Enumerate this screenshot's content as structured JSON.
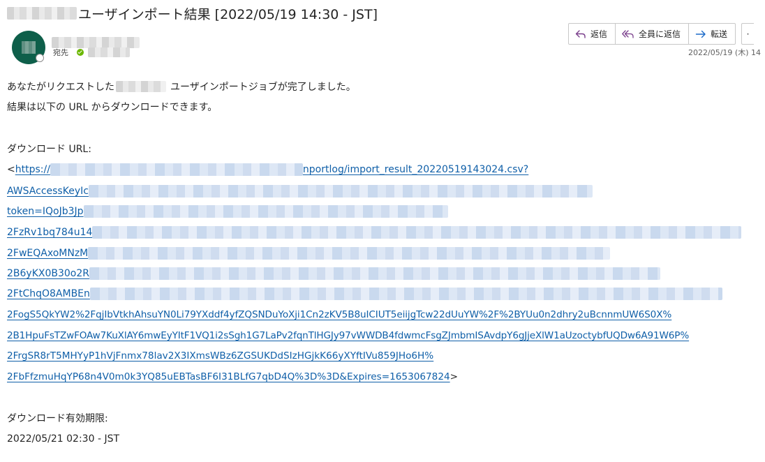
{
  "subject": {
    "text": "ユーザインポート結果 [2022/05/19 14:30 - JST]"
  },
  "header": {
    "to_label": "宛先",
    "date": "2022/05/19 (木) 14"
  },
  "toolbar": {
    "reply": "返信",
    "reply_all": "全員に返信",
    "forward": "転送",
    "more": "·"
  },
  "body": {
    "line1_pre": "あなたがリクエストした",
    "line1_post": "ユーザインポートジョブが完了しました。",
    "line2": "結果は以下の URL からダウンロードできます。",
    "download_url_label": "ダウンロード URL:",
    "url_open": "<",
    "url_close": ">",
    "url_lines": [
      {
        "pre": "https://",
        "post": "nportlog/import_result_20220519143024.csv?"
      },
      {
        "pre": "AWSAccessKeyIc",
        "post": ""
      },
      {
        "pre": "token=IQoJb3Jp",
        "post": ""
      },
      {
        "pre": "2FzRv1bq784u14",
        "post": ""
      },
      {
        "pre": "2FwEQAxoMNzM",
        "post": ""
      },
      {
        "pre": "2B6yKX0B30o2R",
        "post": ""
      },
      {
        "pre": "2FtChqO8AMBEn",
        "post": ""
      },
      {
        "pre": "2FogS5QkYW2%2FqjIbVtkhAhsuYN0Li79YXddf4yfZQSNDuYoXji1Cn2zKV5B8uICIUT5eiijgTcw22dUuYW%2F%2BYUu0n2dhry2uBcnnmUW6S0X%",
        "post": ""
      },
      {
        "pre": "2B1HpuFsTZwFOAw7KuXlAY6mwEyYItF1VQ1i2sSgh1G7LaPv2fqnTlHGJy97vWWDB4fdwmcFsgZJmbmISAvdpY6gJjeXlW1aUzoctybfUQDw6A91W6P%",
        "post": ""
      },
      {
        "pre": "2FrgSR8rT5MHYyP1hVjFnmx78lav2X3IXmsWBz6ZGSUKDdSIzHGjkK66yXYftIVu859JHo6H%",
        "post": ""
      },
      {
        "pre": "2FbFfzmuHqYP68n4V0m0k3YQ85uEBTasBF6I31BLfG7qbD4Q%3D%3D&Expires=1653067824",
        "post": ""
      }
    ],
    "expiry_label": "ダウンロード有効期限:",
    "expiry_value": "2022/05/21 02:30 - JST"
  },
  "colors": {
    "link": "#0f5fa8",
    "avatar": "#0e5f4a",
    "reply_icon": "#7a3f8c",
    "forward_icon": "#1b6ac9"
  }
}
